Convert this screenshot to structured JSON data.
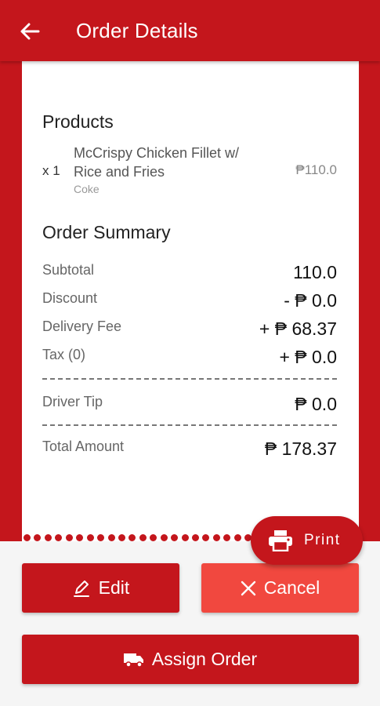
{
  "appbar": {
    "title": "Order Details",
    "back_icon": "arrow-left-icon"
  },
  "products": {
    "title": "Products",
    "items": [
      {
        "qty": "x 1",
        "name": "McCrispy Chicken Fillet w/ Rice and Fries",
        "note": "Coke",
        "price": "₱110.0"
      }
    ]
  },
  "summary": {
    "title": "Order Summary",
    "subtotal": {
      "label": "Subtotal",
      "value": "110.0"
    },
    "discount": {
      "label": "Discount",
      "value": "- ₱ 0.0"
    },
    "delivery_fee": {
      "label": "Delivery Fee",
      "value": "+ ₱ 68.37"
    },
    "tax": {
      "label": "Tax (0)",
      "value": "+ ₱ 0.0"
    },
    "driver_tip": {
      "label": "Driver Tip",
      "value": "₱ 0.0"
    },
    "total": {
      "label": "Total Amount",
      "value": "₱ 178.37"
    }
  },
  "actions": {
    "print_label": "Print",
    "print_icon": "printer-icon",
    "edit_label": "Edit",
    "edit_icon": "pencil-icon",
    "cancel_label": "Cancel",
    "cancel_icon": "close-icon",
    "assign_label": "Assign Order",
    "assign_icon": "truck-icon"
  },
  "colors": {
    "primary": "#c4161c",
    "cancel": "#f1483f",
    "panel": "#f5f5f5"
  }
}
